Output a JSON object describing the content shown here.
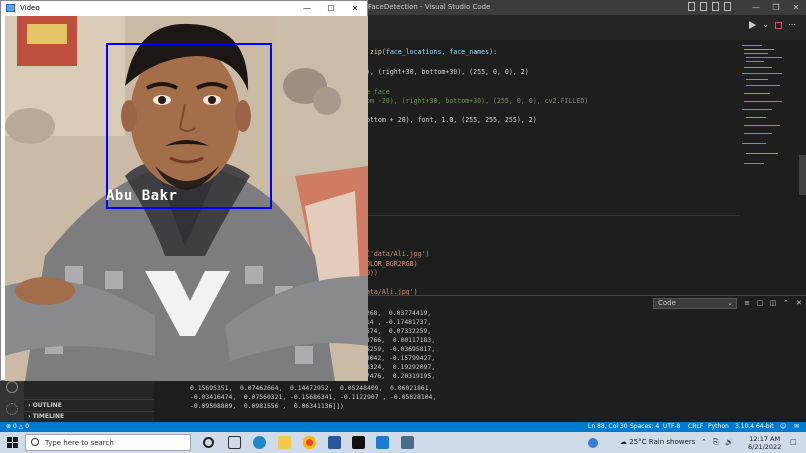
{
  "vscode": {
    "window_title": "FaceDetection - Visual Studio Code",
    "code_lines": [
      {
        "segments": [
          {
            "t": "n zip(face_locations, face_names):",
            "c": "c-fn"
          }
        ]
      },
      {
        "segments": [
          {
            "t": "0), (right+30, bottom+30), (255, 0, 0), 2)",
            "c": ""
          }
        ]
      },
      {
        "segments": [
          {
            "t": "he face",
            "c": "c-cm"
          }
        ]
      },
      {
        "segments": [
          {
            "t": "tom -20), (right+30, bottom+30), (255, 0, 0), cv2.FILLED)",
            "c": "c-cm"
          }
        ]
      },
      {
        "segments": [
          {
            "t": "bottom + 20), font, 1.0, (255, 255, 255), 2)",
            "c": ""
          }
        ]
      },
      {
        "segments": [
          {
            "t": "e('data/Ali.jpg')",
            "c": "c-str"
          }
        ]
      },
      {
        "segments": [
          {
            "t": "COLOR_BGR2RGB)",
            "c": "c-str"
          }
        ]
      },
      {
        "segments": [
          {
            "t": "00))",
            "c": "c-str"
          }
        ]
      },
      {
        "segments": [
          {
            "t": "data/Ali.jpg')",
            "c": "c-str"
          }
        ]
      }
    ]
  },
  "panel": {
    "output_select": "Code",
    "right_fragments": [
      "2268,  0.03774419,",
      "214 , -0.17481737,",
      "2574,  0.07332259,",
      "78766,  0.00117183,",
      "05259, -0.03695817,",
      "03042, -0.15799427,",
      "88324,  0.19292097,",
      "37476,  0.20319195,"
    ],
    "full_lines": [
      "0.15695351,  0.07462664,  0.14472952,  0.05248409,  0.06021861,",
      "-0.03416474,  0.07560321, -0.15686341, -0.1122907 , -0.05828104,",
      "-0.09508809,  0.0981556 ,  0.06341136]])"
    ]
  },
  "sidebar": {
    "outline": "OUTLINE",
    "timeline": "TIMELINE"
  },
  "statusbar": {
    "errors": "0",
    "warnings": "0",
    "position": "Ln 88, Col 30",
    "spaces": "Spaces: 4",
    "encoding": "UTF-8",
    "eol": "CRLF",
    "language": "Python",
    "interpreter": "3.10.4 64-bit"
  },
  "taskbar": {
    "search_placeholder": "Type here to search",
    "weather": "25°C  Rain showers",
    "time": "12:17 AM",
    "date": "6/21/2022"
  },
  "video_window": {
    "title": "Video",
    "face_label": "Abu Bakr",
    "box_color": "#0000ff"
  }
}
